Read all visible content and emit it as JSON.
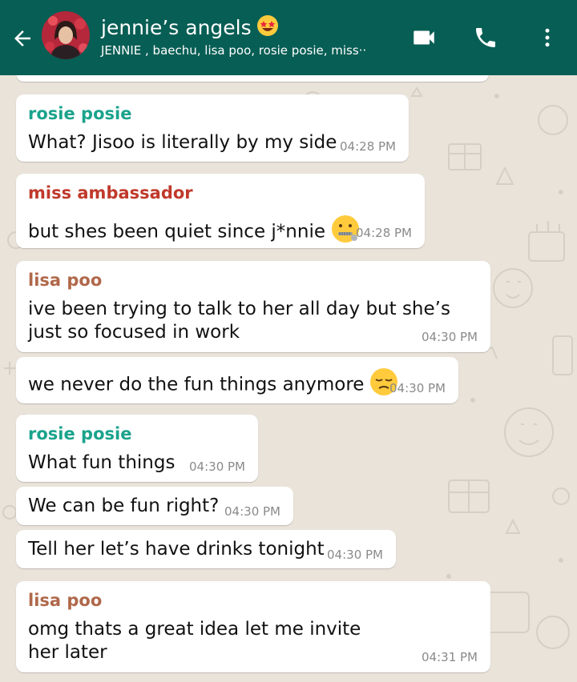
{
  "header": {
    "back_icon": "arrow-left-icon",
    "title": "jennie’s angels",
    "title_emoji": "star-struck-emoji",
    "subtitle": "JENNIE , baechu, lisa poo, rosie posie, miss··",
    "actions": [
      "video-call-icon",
      "phone-icon",
      "more-vert-icon"
    ],
    "colors": {
      "appbar": "#075e54"
    }
  },
  "messages": [
    {
      "sender": "rosie posie",
      "sender_color": "#1aa38c",
      "text": "What? Jisoo is literally by my side",
      "time": "04:28 PM"
    },
    {
      "sender": "miss ambassador",
      "sender_color": "#c0392b",
      "text": "but shes been quiet since j*nnie",
      "emoji": "zipper-mouth-emoji",
      "time": "04:28 PM"
    },
    {
      "sender": "lisa poo",
      "sender_color": "#b0684a",
      "text": "ive been trying to talk to her all day but she’s just so focused in work",
      "time": "04:30 PM"
    },
    {
      "sender": "",
      "text": "we never do the fun things anymore",
      "emoji": "pensive-emoji",
      "time": "04:30 PM"
    },
    {
      "sender": "rosie posie",
      "sender_color": "#1aa38c",
      "text": "What fun things",
      "time": "04:30 PM"
    },
    {
      "sender": "",
      "text": "We can be fun right?",
      "time": "04:30 PM"
    },
    {
      "sender": "",
      "text": "Tell her let’s have drinks tonight",
      "time": "04:30 PM"
    },
    {
      "sender": "lisa poo",
      "sender_color": "#b0684a",
      "text": "omg thats a great idea let me invite her later",
      "time": "04:31 PM"
    }
  ]
}
